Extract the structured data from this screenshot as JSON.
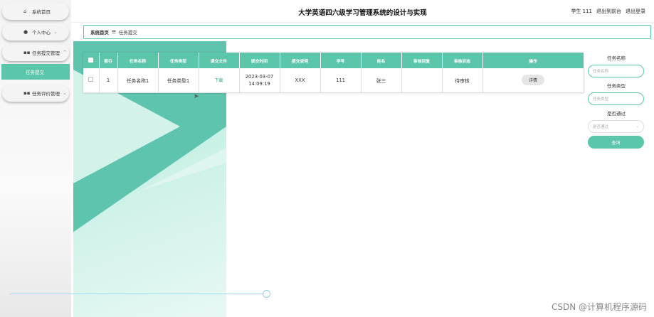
{
  "header": {
    "title": "大学英语四六级学习管理系统的设计与实现",
    "user": "学生 111",
    "back_front": "退出到前台",
    "logout": "退出登录"
  },
  "sidebar": {
    "items": [
      {
        "label": "系统首页",
        "icon": "home-icon"
      },
      {
        "label": "个人中心",
        "icon": "user-icon"
      },
      {
        "label": "任务提交管理",
        "icon": "grid-icon"
      },
      {
        "label": "任务评价管理",
        "icon": "grid-icon"
      }
    ],
    "submenu": {
      "label": "任务提交"
    }
  },
  "breadcrumb": {
    "home": "系统首页",
    "sep": "☰",
    "current": "任务提交"
  },
  "table": {
    "headers": [
      "索引",
      "任务名称",
      "任务类型",
      "提交文件",
      "提交时间",
      "提交说明",
      "学号",
      "姓名",
      "审核回复",
      "审核状态",
      "操作"
    ],
    "rows": [
      {
        "index": "1",
        "name": "任务名称1",
        "type": "任务类型1",
        "file": "下载",
        "time": "2023-03-07 14:09:19",
        "desc": "XXX",
        "sno": "111",
        "sname": "张三",
        "reply": "",
        "status": "待审核",
        "action": "详情"
      }
    ]
  },
  "search": {
    "name_label": "任务名称",
    "name_placeholder": "任务名称",
    "type_label": "任务类型",
    "type_placeholder": "任务类型",
    "pass_label": "是否通过",
    "pass_placeholder": "是否通过",
    "button": "查询"
  },
  "watermark": "CSDN @计算机程序源码",
  "colors": {
    "accent": "#5bc6aa"
  }
}
